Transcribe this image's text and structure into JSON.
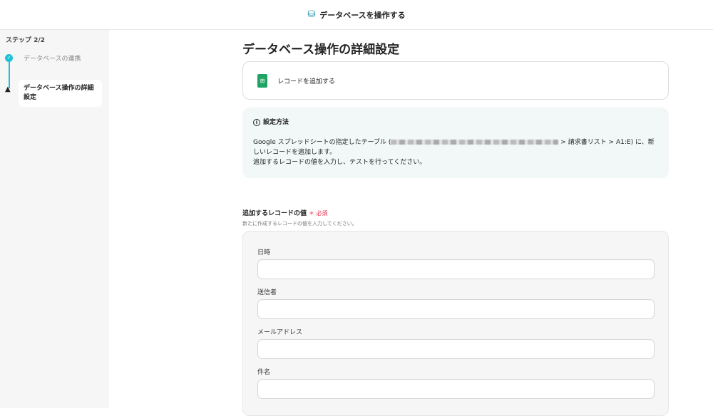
{
  "header": {
    "title": "データベースを操作する",
    "icon": "database-icon"
  },
  "sidebar": {
    "step": "ステップ 2/2",
    "steps": [
      {
        "label": "データベースの連携",
        "status": "done"
      },
      {
        "label": "データベース操作の詳細設定",
        "status": "warning"
      }
    ]
  },
  "main": {
    "title": "データベース操作の詳細設定",
    "action": {
      "label": "レコードを追加する",
      "icon": "google-sheets-icon"
    },
    "info": {
      "title": "設定方法",
      "line1_pre": "Google スプレッドシートの指定したテーブル (",
      "line1_post": " > 請求書リスト > A1:E) に、新しいレコードを追加します。",
      "line2": "追加するレコードの値を入力し、テストを行ってください。"
    },
    "section": {
      "label": "追加するレコードの値",
      "required": "＊ 必須",
      "description": "新たに作成するレコードの値を入力してください。"
    },
    "fields": [
      {
        "label": "日時",
        "value": ""
      },
      {
        "label": "送信者",
        "value": ""
      },
      {
        "label": "メールアドレス",
        "value": ""
      },
      {
        "label": "件名",
        "value": ""
      }
    ]
  }
}
